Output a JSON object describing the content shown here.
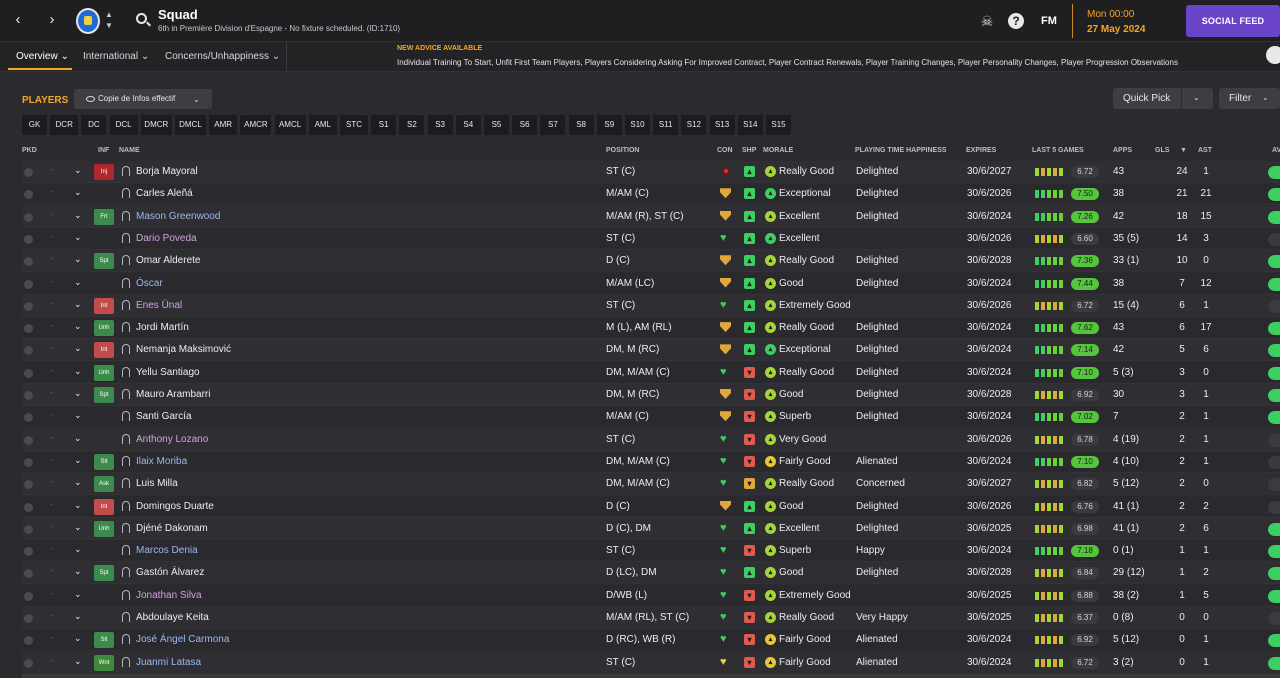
{
  "topbar": {
    "title": "Squad",
    "subtitle": "6th in Première Division d'Espagne - No fixture scheduled. (ID:1710)",
    "fm_label": "FM",
    "date_time": "Mon 00:00",
    "date_day": "27 May 2024",
    "social_label": "SOCIAL FEED",
    "help_icon": "?"
  },
  "tabs": [
    "Overview ⌄",
    "International ⌄",
    "Concerns/Unhappiness ⌄"
  ],
  "advice": {
    "title": "NEW ADVICE AVAILABLE",
    "text": "Individual Training To Start, Unfit First Team Players, Players Considering Asking For Improved Contract, Player Contract Renewals, Player Training Changes, Player Personality Changes, Player Progression Observations"
  },
  "toolbar": {
    "players_label": "PLAYERS",
    "view_label": "Copie de Infos effectif",
    "quick_pick": "Quick Pick",
    "filter": "Filter"
  },
  "positions": [
    "GK",
    "DCR",
    "DC",
    "DCL",
    "DMCR",
    "DMCL",
    "AMR",
    "AMCR",
    "AMCL",
    "AML",
    "STC",
    "S1",
    "S2",
    "S3",
    "S4",
    "S5",
    "S6",
    "S7",
    "S8",
    "S9",
    "S10",
    "S11",
    "S12",
    "S13",
    "S14",
    "S15"
  ],
  "columns": {
    "pkd": "PKD",
    "inf": "INF",
    "name": "NAME",
    "position": "POSITION",
    "con": "CON",
    "shp": "SHP",
    "morale": "MORALE",
    "pth": "PLAYING TIME HAPPINESS",
    "expires": "EXPIRES",
    "last5": "LAST 5 GAMES",
    "apps": "APPS",
    "gls": "GLS",
    "sort": "▼",
    "ast": "AST",
    "av": "AV"
  },
  "players": [
    {
      "inf": "Inj",
      "name": "Borja Mayoral",
      "position": "ST (C)",
      "morale": "Really Good",
      "pth": "Delighted",
      "expires": "30/6/2027",
      "rating": "6.72",
      "apps": "43",
      "gls": "24",
      "ast": "1"
    },
    {
      "inf": "",
      "name": "Carles Aleñá",
      "position": "M/AM (C)",
      "morale": "Exceptional",
      "pth": "Delighted",
      "expires": "30/6/2026",
      "rating": "7.50",
      "apps": "38",
      "gls": "21",
      "ast": "21"
    },
    {
      "inf": "Frt",
      "name": "Mason Greenwood",
      "position": "M/AM (R), ST (C)",
      "morale": "Excellent",
      "pth": "Delighted",
      "expires": "30/6/2024",
      "rating": "7.26",
      "apps": "42",
      "gls": "18",
      "ast": "15"
    },
    {
      "inf": "",
      "name": "Dario Poveda",
      "position": "ST (C)",
      "morale": "Excellent",
      "pth": "",
      "expires": "30/6/2026",
      "rating": "6.60",
      "apps": "35 (5)",
      "gls": "14",
      "ast": "3"
    },
    {
      "inf": "Spt",
      "name": "Omar Alderete",
      "position": "D (C)",
      "morale": "Really Good",
      "pth": "Delighted",
      "expires": "30/6/2028",
      "rating": "7.36",
      "apps": "33 (1)",
      "gls": "10",
      "ast": "0"
    },
    {
      "inf": "",
      "name": "Óscar",
      "position": "M/AM (LC)",
      "morale": "Good",
      "pth": "Delighted",
      "expires": "30/6/2024",
      "rating": "7.44",
      "apps": "38",
      "gls": "7",
      "ast": "12"
    },
    {
      "inf": "Int",
      "name": "Enes Ünal",
      "position": "ST (C)",
      "morale": "Extremely Good",
      "pth": "",
      "expires": "30/6/2026",
      "rating": "6.72",
      "apps": "15 (4)",
      "gls": "6",
      "ast": "1"
    },
    {
      "inf": "Unh",
      "name": "Jordi Martín",
      "position": "M (L), AM (RL)",
      "morale": "Really Good",
      "pth": "Delighted",
      "expires": "30/6/2024",
      "rating": "7.62",
      "apps": "43",
      "gls": "6",
      "ast": "17"
    },
    {
      "inf": "Int",
      "name": "Nemanja Maksimović",
      "position": "DM, M (RC)",
      "morale": "Exceptional",
      "pth": "Delighted",
      "expires": "30/6/2024",
      "rating": "7.14",
      "apps": "42",
      "gls": "5",
      "ast": "6"
    },
    {
      "inf": "Unh",
      "name": "Yellu Santiago",
      "position": "DM, M/AM (C)",
      "morale": "Really Good",
      "pth": "Delighted",
      "expires": "30/6/2024",
      "rating": "7.10",
      "apps": "5 (3)",
      "gls": "3",
      "ast": "0"
    },
    {
      "inf": "Spt",
      "name": "Mauro Arambarri",
      "position": "DM, M (RC)",
      "morale": "Good",
      "pth": "Delighted",
      "expires": "30/6/2028",
      "rating": "6.92",
      "apps": "30",
      "gls": "3",
      "ast": "1"
    },
    {
      "inf": "",
      "name": "Santi García",
      "position": "M/AM (C)",
      "morale": "Superb",
      "pth": "Delighted",
      "expires": "30/6/2024",
      "rating": "7.02",
      "apps": "7",
      "gls": "2",
      "ast": "1"
    },
    {
      "inf": "",
      "name": "Anthony Lozano",
      "position": "ST (C)",
      "morale": "Very Good",
      "pth": "",
      "expires": "30/6/2026",
      "rating": "6.78",
      "apps": "4 (19)",
      "gls": "2",
      "ast": "1"
    },
    {
      "inf": "Slt",
      "name": "Ilaix Moriba",
      "position": "DM, M/AM (C)",
      "morale": "Fairly Good",
      "pth": "Alienated",
      "expires": "30/6/2024",
      "rating": "7.10",
      "apps": "4 (10)",
      "gls": "2",
      "ast": "1"
    },
    {
      "inf": "Ask",
      "name": "Luis Milla",
      "position": "DM, M/AM (C)",
      "morale": "Really Good",
      "pth": "Concerned",
      "expires": "30/6/2027",
      "rating": "6.82",
      "apps": "5 (12)",
      "gls": "2",
      "ast": "0"
    },
    {
      "inf": "Int",
      "name": "Domingos Duarte",
      "position": "D (C)",
      "morale": "Good",
      "pth": "Delighted",
      "expires": "30/6/2026",
      "rating": "6.76",
      "apps": "41 (1)",
      "gls": "2",
      "ast": "2"
    },
    {
      "inf": "Unh",
      "name": "Djéné Dakonam",
      "position": "D (C), DM",
      "morale": "Excellent",
      "pth": "Delighted",
      "expires": "30/6/2025",
      "rating": "6.98",
      "apps": "41 (1)",
      "gls": "2",
      "ast": "6"
    },
    {
      "inf": "",
      "name": "Marcos Denia",
      "position": "ST (C)",
      "morale": "Superb",
      "pth": "Happy",
      "expires": "30/6/2024",
      "rating": "7.18",
      "apps": "0 (1)",
      "gls": "1",
      "ast": "1"
    },
    {
      "inf": "Spt",
      "name": "Gastón Álvarez",
      "position": "D (LC), DM",
      "morale": "Good",
      "pth": "Delighted",
      "expires": "30/6/2028",
      "rating": "6.84",
      "apps": "29 (12)",
      "gls": "1",
      "ast": "2"
    },
    {
      "inf": "",
      "name": "Jonathan Silva",
      "position": "D/WB (L)",
      "morale": "Extremely Good",
      "pth": "",
      "expires": "30/6/2025",
      "rating": "6.88",
      "apps": "38 (2)",
      "gls": "1",
      "ast": "5"
    },
    {
      "inf": "",
      "name": "Abdoulaye Keita",
      "position": "M/AM (RL), ST (C)",
      "morale": "Really Good",
      "pth": "Very Happy",
      "expires": "30/6/2025",
      "rating": "6.37",
      "apps": "0 (8)",
      "gls": "0",
      "ast": "0"
    },
    {
      "inf": "Slt",
      "name": "José Ángel Carmona",
      "position": "D (RC), WB (R)",
      "morale": "Fairly Good",
      "pth": "Alienated",
      "expires": "30/6/2024",
      "rating": "6.92",
      "apps": "5 (12)",
      "gls": "0",
      "ast": "1"
    },
    {
      "inf": "Wnt",
      "name": "Juanmi Latasa",
      "position": "ST (C)",
      "morale": "Fairly Good",
      "pth": "Alienated",
      "expires": "30/6/2024",
      "rating": "6.72",
      "apps": "3 (2)",
      "gls": "0",
      "ast": "1"
    }
  ]
}
